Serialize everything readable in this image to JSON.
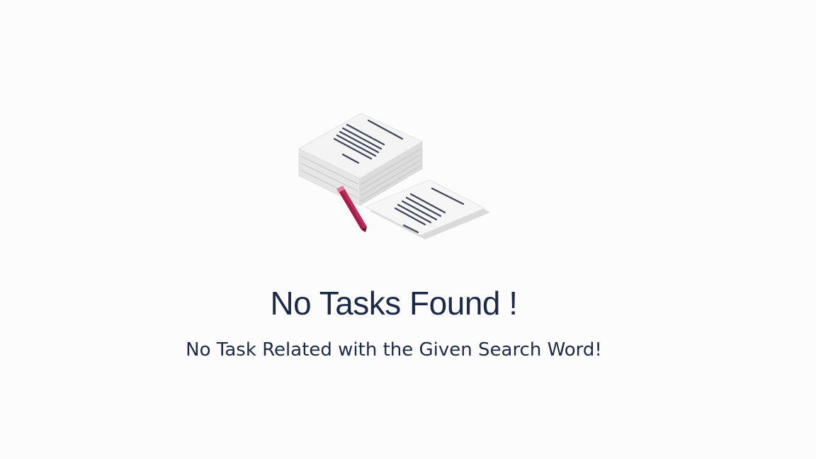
{
  "empty_state": {
    "illustration_icon": "document-stack-with-pen-icon",
    "title": "No Tasks Found !",
    "message": "No Task Related with the Given Search Word!"
  },
  "colors": {
    "background": "#fcfcfc",
    "text": "#1c2a4a",
    "pen": "#c2285a"
  }
}
